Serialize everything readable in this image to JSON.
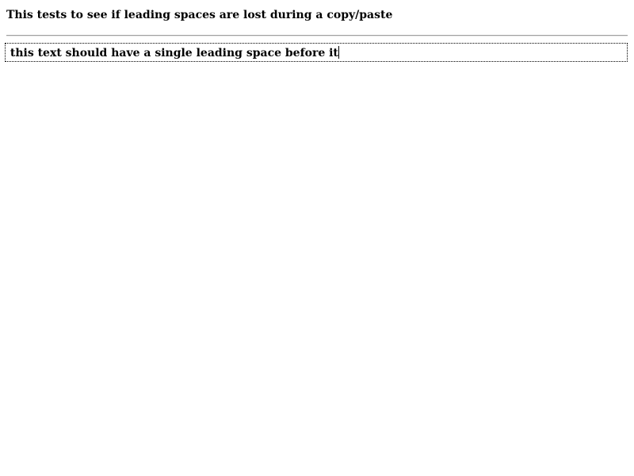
{
  "heading": "This tests to see if leading spaces are lost during a copy/paste",
  "editor": {
    "text": " this text should have a single leading space before it"
  }
}
